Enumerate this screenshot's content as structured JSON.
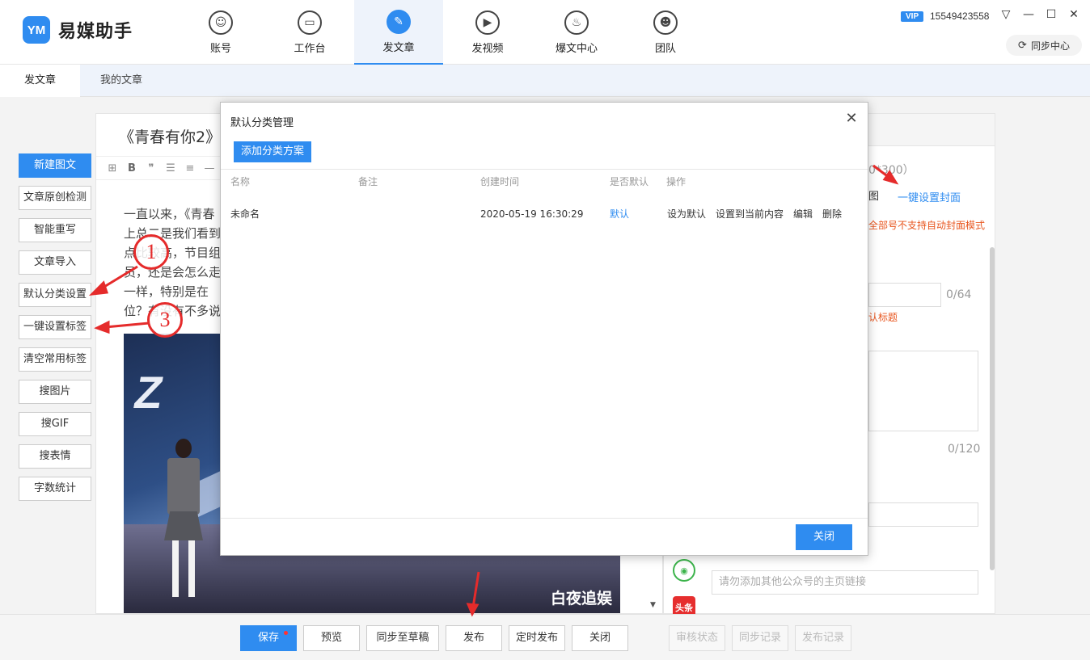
{
  "app": {
    "name": "易媒助手",
    "logo_mark": "YM",
    "vip_label": "VIP",
    "phone": "15549423558",
    "sync_center": "同步中心"
  },
  "nav": [
    {
      "label": "账号",
      "icon": "user-icon"
    },
    {
      "label": "工作台",
      "icon": "monitor-icon"
    },
    {
      "label": "发文章",
      "icon": "feather-icon",
      "active": true
    },
    {
      "label": "发视频",
      "icon": "play-icon"
    },
    {
      "label": "爆文中心",
      "icon": "fire-icon"
    },
    {
      "label": "团队",
      "icon": "team-icon"
    }
  ],
  "tabs": [
    {
      "label": "发文章",
      "active": true
    },
    {
      "label": "我的文章"
    }
  ],
  "tools": [
    {
      "label": "新建图文",
      "primary": true
    },
    {
      "label": "文章原创检测"
    },
    {
      "label": "智能重写"
    },
    {
      "label": "文章导入"
    },
    {
      "label": "默认分类设置"
    },
    {
      "label": "一键设置标签"
    },
    {
      "label": "清空常用标签"
    },
    {
      "label": "搜图片"
    },
    {
      "label": "搜GIF"
    },
    {
      "label": "搜表情"
    },
    {
      "label": "字数统计"
    }
  ],
  "editor": {
    "title": "《青春有你2》",
    "lines": [
      "一直以来，《青春",
      "上总二是我们看到",
      "点比较高，节目组",
      "员，还是会怎么走",
      "一样，特别是在",
      "位？有没有不多说"
    ],
    "photo_watermark": "白夜追娱",
    "photo_letter": "Z"
  },
  "right_panel": {
    "cover_hint": "0*300）",
    "cover_icon_char": "图",
    "one_click_cover": "一键设置封面",
    "cover_warning": "全部号不支持自动封面模式",
    "title_count": "0/64",
    "title_hint": "认标题",
    "summary_count": "0/120",
    "link_placeholder": "请勿添加其他公众号的主页链接",
    "toutiao_label": "头条"
  },
  "bottom": {
    "save": "保存",
    "preview": "预览",
    "sync_draft": "同步至草稿",
    "publish": "发布",
    "scheduled": "定时发布",
    "close": "关闭",
    "review_status": "审核状态",
    "sync_record": "同步记录",
    "publish_record": "发布记录"
  },
  "modal": {
    "title": "默认分类管理",
    "add_button": "添加分类方案",
    "columns": [
      "名称",
      "备注",
      "创建时间",
      "是否默认",
      "操作"
    ],
    "rows": [
      {
        "name": "未命名",
        "note": "",
        "created": "2020-05-19 16:30:29",
        "is_default": "默认",
        "actions": [
          "设为默认",
          "设置到当前内容",
          "编辑",
          "删除"
        ]
      }
    ],
    "close_button": "关闭"
  },
  "annotations": [
    "1",
    "3"
  ],
  "colors": {
    "accent": "#2f8cf0",
    "annotation": "#e52b2b",
    "warning": "#e8561f"
  }
}
